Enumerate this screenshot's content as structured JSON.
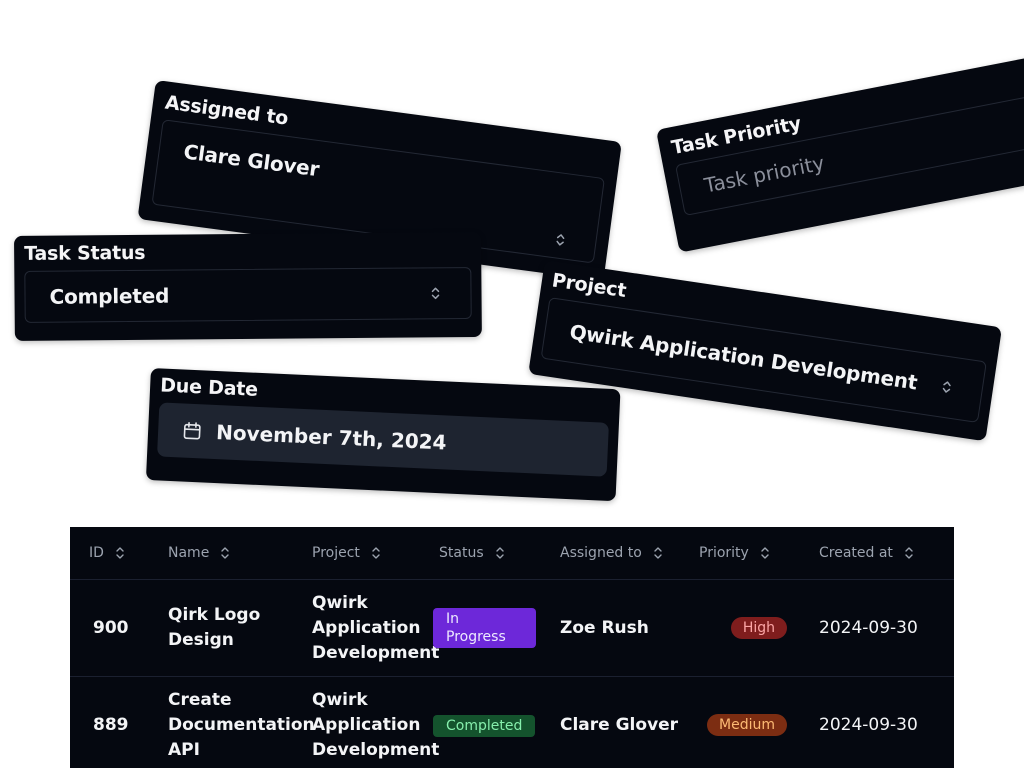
{
  "cards": {
    "assigned": {
      "label": "Assigned to",
      "value": "Clare Glover"
    },
    "priority": {
      "label": "Task Priority",
      "placeholder": "Task priority"
    },
    "status": {
      "label": "Task Status",
      "value": "Completed"
    },
    "project": {
      "label": "Project",
      "value": "Qwirk Application Development"
    },
    "due": {
      "label": "Due Date",
      "value": "November 7th, 2024"
    }
  },
  "table": {
    "headers": [
      "ID",
      "Name",
      "Project",
      "Status",
      "Assigned to",
      "Priority",
      "Created at"
    ],
    "rows": [
      {
        "id": "900",
        "name": "Qirk Logo Design",
        "project": "Qwirk Application Development",
        "status": "In Progress",
        "assigned": "Zoe Rush",
        "priority": "High",
        "created": "2024-09-30"
      },
      {
        "id": "889",
        "name": "Create Documentation API",
        "project": "Qwirk Application Development",
        "status": "Completed",
        "assigned": "Clare Glover",
        "priority": "Medium",
        "created": "2024-09-30"
      }
    ]
  },
  "colors": {
    "card_bg": "#050810",
    "in_progress": "#6d28d9",
    "completed": "#14532d",
    "high": "#7f1d1d",
    "medium": "#7c2d12"
  },
  "icons": [
    "chevron-updown-icon",
    "calendar-icon",
    "sort-icon"
  ]
}
